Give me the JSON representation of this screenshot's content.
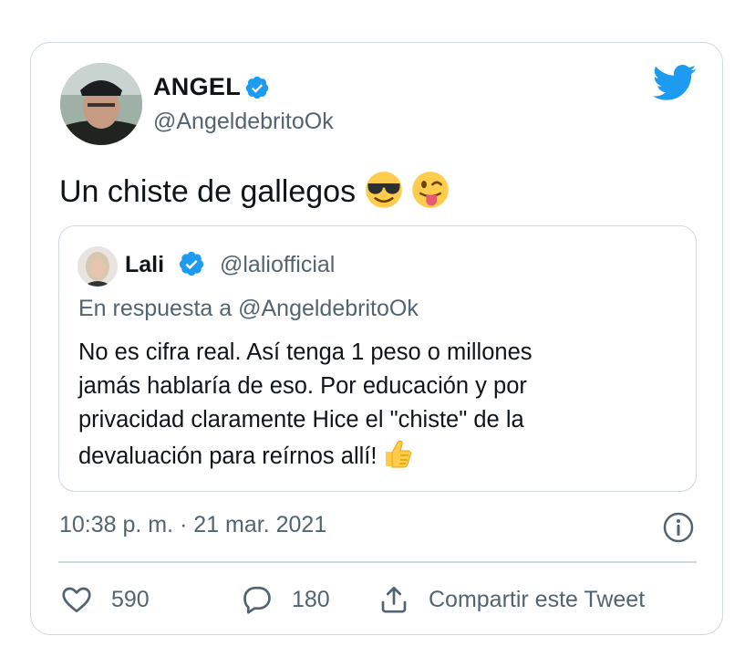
{
  "tweet": {
    "author_name": "ANGEL",
    "author_handle": "@AngeldebritoOk",
    "text": "Un chiste de gallegos",
    "emojis": [
      "smiling-face-with-sunglasses",
      "winking-face-with-tongue"
    ],
    "timestamp": "10:38 p. m. · 21 mar. 2021"
  },
  "quote": {
    "author_name": "Lali",
    "author_handle": "@laliofficial",
    "reply_to": "En respuesta a @AngeldebritoOk",
    "text": "No es cifra real. Así tenga 1 peso o millones\njamás hablaría de eso. Por educación y por\nprivacidad claramente Hice el \"chiste\" de la\ndevaluación para reírnos allí!",
    "emoji": "thumbs-up"
  },
  "actions": {
    "likes": "590",
    "replies": "180",
    "share_label": "Compartir este Tweet"
  },
  "colors": {
    "brand": "#1d9bf0",
    "text": "#0f1419",
    "secondary": "#536471",
    "border": "#cfd9de"
  }
}
